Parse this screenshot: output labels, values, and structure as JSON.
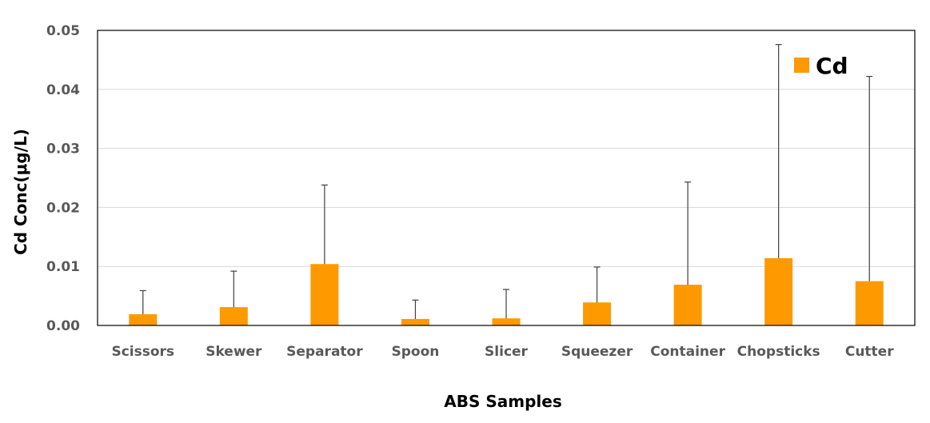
{
  "chart_data": {
    "type": "bar",
    "title": "",
    "xlabel": "ABS Samples",
    "ylabel": "Cd Conc(μg/L)",
    "ylim": [
      0,
      0.05
    ],
    "yticks": [
      0.0,
      0.01,
      0.02,
      0.03,
      0.04,
      0.05
    ],
    "ytick_labels": [
      "0.00",
      "0.01",
      "0.02",
      "0.03",
      "0.04",
      "0.05"
    ],
    "grid": true,
    "legend_position": "top-right",
    "categories": [
      "Scissors",
      "Skewer",
      "Separator",
      "Spoon",
      "Slicer",
      "Squeezer",
      "Container",
      "Chopsticks",
      "Cutter"
    ],
    "series": [
      {
        "name": "Cd",
        "color": "#ff9900",
        "values": [
          0.0019,
          0.0031,
          0.0104,
          0.0011,
          0.0012,
          0.0039,
          0.0069,
          0.0114,
          0.0075
        ],
        "error_upper": [
          0.004,
          0.0061,
          0.0134,
          0.0032,
          0.0049,
          0.006,
          0.0174,
          0.0362,
          0.0347
        ]
      }
    ]
  }
}
